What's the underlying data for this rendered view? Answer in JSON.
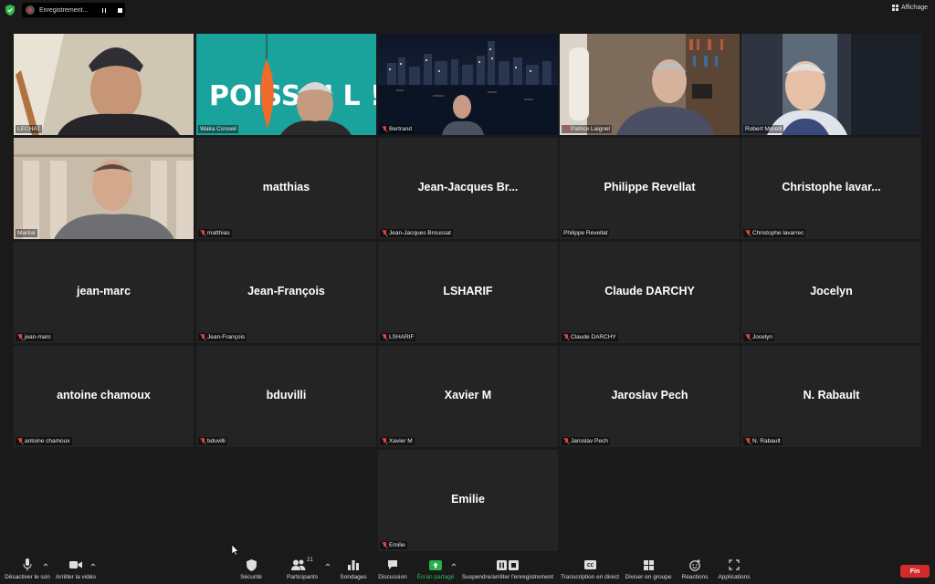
{
  "topbar": {
    "recording_label": "Enregistrement...",
    "view_label": "Affichage"
  },
  "participants": [
    {
      "display": "",
      "name": "LECHAT",
      "muted": false,
      "video": true,
      "active": true
    },
    {
      "display": "",
      "name": "Waka Conseil",
      "muted": false,
      "video": true,
      "sign_text": "POISS N   L !"
    },
    {
      "display": "",
      "name": "Bertrand",
      "muted": true,
      "video": true
    },
    {
      "display": "",
      "name": "Patrice Laignel",
      "muted": true,
      "video": true
    },
    {
      "display": "",
      "name": "Robert Morelli",
      "muted": false,
      "video": true
    },
    {
      "display": "",
      "name": "Martial",
      "muted": false,
      "video": true
    },
    {
      "display": "matthias",
      "name": "matthias",
      "muted": true,
      "video": false
    },
    {
      "display": "Jean-Jacques  Br...",
      "name": "Jean-Jacques Broussat",
      "muted": true,
      "video": false
    },
    {
      "display": "Philippe Revellat",
      "name": "Philippe Revellat",
      "muted": false,
      "video": false
    },
    {
      "display": "Christophe  lavar...",
      "name": "Christophe lavarrec",
      "muted": true,
      "video": false
    },
    {
      "display": "jean-marc",
      "name": "jean-marc",
      "muted": true,
      "video": false
    },
    {
      "display": "Jean-François",
      "name": "Jean-François",
      "muted": true,
      "video": false
    },
    {
      "display": "LSHARIF",
      "name": "LSHARIF",
      "muted": true,
      "video": false
    },
    {
      "display": "Claude DARCHY",
      "name": "Claude DARCHY",
      "muted": true,
      "video": false
    },
    {
      "display": "Jocelyn",
      "name": "Jocelyn",
      "muted": true,
      "video": false
    },
    {
      "display": "antoine chamoux",
      "name": "antoine chamoux",
      "muted": true,
      "video": false
    },
    {
      "display": "bduvilli",
      "name": "bduvilli",
      "muted": true,
      "video": false
    },
    {
      "display": "Xavier M",
      "name": "Xavier M",
      "muted": true,
      "video": false
    },
    {
      "display": "Jaroslav Pech",
      "name": "Jaroslav Pech",
      "muted": true,
      "video": false
    },
    {
      "display": "N. Rabault",
      "name": "N. Rabault",
      "muted": true,
      "video": false
    },
    {
      "display": "Emilie",
      "name": "Emilie",
      "muted": true,
      "video": false
    }
  ],
  "toolbar": {
    "mute": "Désactiver le son",
    "video": "Arrêter la vidéo",
    "security": "Sécurité",
    "participants": "Participants",
    "participants_count": "21",
    "polls": "Sondages",
    "chat": "Discussion",
    "share": "Écran partagé",
    "record": "Suspendre/arrêter l'enregistrement",
    "transcript": "Transcription en direct",
    "breakout": "Diviser en groupe",
    "reactions": "Réactions",
    "apps": "Applications",
    "end": "Fin"
  },
  "colors": {
    "active_speaker": "#d8e066",
    "share_green": "#22b14c",
    "end_red": "#d12b2b",
    "muted_red": "#e04444"
  }
}
